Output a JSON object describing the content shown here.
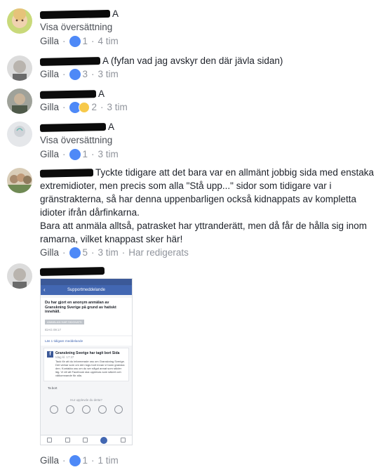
{
  "colors": {
    "like_blue": "#4e89f7",
    "meta_gray": "#90949c",
    "text": "#1d2129"
  },
  "comments": [
    {
      "text": "A",
      "translate": "Visa översättning",
      "like": "Gilla",
      "reactions": "1",
      "time": "4 tim",
      "reaction_icons": [
        "like-icon"
      ]
    },
    {
      "text": "A (fyfan vad jag avskyr den där jävla sidan)",
      "like": "Gilla",
      "reactions": "3",
      "time": "3 tim",
      "reaction_icons": [
        "like-icon"
      ]
    },
    {
      "text": "A",
      "like": "Gilla",
      "reactions": "2",
      "time": "3 tim",
      "reaction_icons": [
        "like-icon",
        "wow-icon"
      ]
    },
    {
      "text": "A",
      "translate": "Visa översättning",
      "like": "Gilla",
      "reactions": "1",
      "time": "3 tim",
      "reaction_icons": [
        "like-icon"
      ]
    },
    {
      "text": "Tyckte tidigare att det bara var en allmänt jobbig sida med enstaka extremidioter, men precis som alla \"Stå upp...\" sidor som tidigare var i gränstrakterna, så har denna uppenbarligen också kidnappats av kompletta idioter ifrån dårfinkarna.",
      "text2": "Bara att anmäla alltså, patrasket har yttranderätt, men då får de hålla sig inom ramarna, vilket knappast sker här!",
      "like": "Gilla",
      "reactions": "5",
      "time": "3 tim",
      "edited": "Har redigerats",
      "reaction_icons": [
        "like-icon"
      ]
    },
    {
      "like": "Gilla",
      "reactions": "1",
      "time": "1 tim",
      "reaction_icons": [
        "like-icon"
      ]
    }
  ],
  "screenshot": {
    "header": "Supportmeddelande",
    "card_title": "Du har gjort en anonym anmälan av Granskning Sverige på grund av hatiskt innehåll.",
    "card_button": "ANMÄLAN HAR SKICKATS",
    "card_time": "IDAG 09:17",
    "link": "Läs 1 tidigare meddelande",
    "msg_title": "Granskning Sverige har tagit bort Sida",
    "msg_time": "Idag kl. 17:37",
    "msg_text": "Tack för att du informerade oss om Granskning Sverige. Det verkar som om den togs bort innan vi hann granska den. Kontakta oss om du ser något annat som stöder läg. Vi vill att Facebook ska upplevas som säkert och välkomnande för alla.",
    "remove": "Ta bort",
    "rate": "Hur upplevde du detta?"
  }
}
